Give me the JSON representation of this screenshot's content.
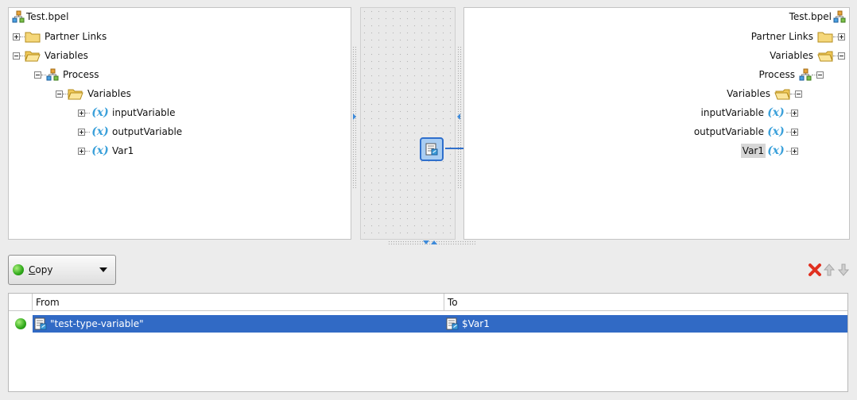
{
  "source_tree": {
    "nodes": [
      {
        "label": "Test.bpel",
        "icon": "process-icon"
      },
      {
        "label": "Partner Links",
        "icon": "folder-icon",
        "toggle": "plus"
      },
      {
        "label": "Variables",
        "icon": "open-folder-icon",
        "toggle": "minus"
      },
      {
        "label": "Process",
        "icon": "process-icon",
        "toggle": "minus"
      },
      {
        "label": "Variables",
        "icon": "open-folder-icon",
        "toggle": "minus"
      },
      {
        "label": "inputVariable",
        "icon": "variable-icon",
        "toggle": "plus"
      },
      {
        "label": "outputVariable",
        "icon": "variable-icon",
        "toggle": "plus"
      },
      {
        "label": "Var1",
        "icon": "variable-icon",
        "toggle": "plus"
      }
    ]
  },
  "target_tree": {
    "nodes": [
      {
        "label": "Test.bpel",
        "icon": "process-icon"
      },
      {
        "label": "Partner Links",
        "icon": "folder-icon",
        "toggle": "plus"
      },
      {
        "label": "Variables",
        "icon": "open-folder-icon",
        "toggle": "minus"
      },
      {
        "label": "Process",
        "icon": "process-icon",
        "toggle": "minus"
      },
      {
        "label": "Variables",
        "icon": "open-folder-icon",
        "toggle": "minus"
      },
      {
        "label": "inputVariable",
        "icon": "variable-icon",
        "toggle": "plus"
      },
      {
        "label": "outputVariable",
        "icon": "variable-icon",
        "toggle": "plus"
      },
      {
        "label": "Var1",
        "icon": "variable-icon",
        "toggle": "plus",
        "selected": true
      }
    ]
  },
  "variable_glyph": "(x)",
  "mapping": {
    "function_icon": "expression-icon",
    "target": "Var1"
  },
  "operation": {
    "label": "Copy",
    "mnemonic": "C",
    "rest": "opy",
    "status_icon": "green-dot-icon"
  },
  "toolbar": {
    "delete_icon": "red-x-icon",
    "up_icon": "up-arrow-icon",
    "down_icon": "down-arrow-icon"
  },
  "rules_table": {
    "columns": [
      "From",
      "To"
    ],
    "rows": [
      {
        "from": "\"test-type-variable\"",
        "to": "$Var1",
        "status_icon": "green-dot-icon",
        "selected": true
      }
    ]
  },
  "colors": {
    "selection": "#316ac5",
    "connector": "#2f6fcc",
    "variable": "#3aa0da",
    "delete": "#e03020"
  }
}
